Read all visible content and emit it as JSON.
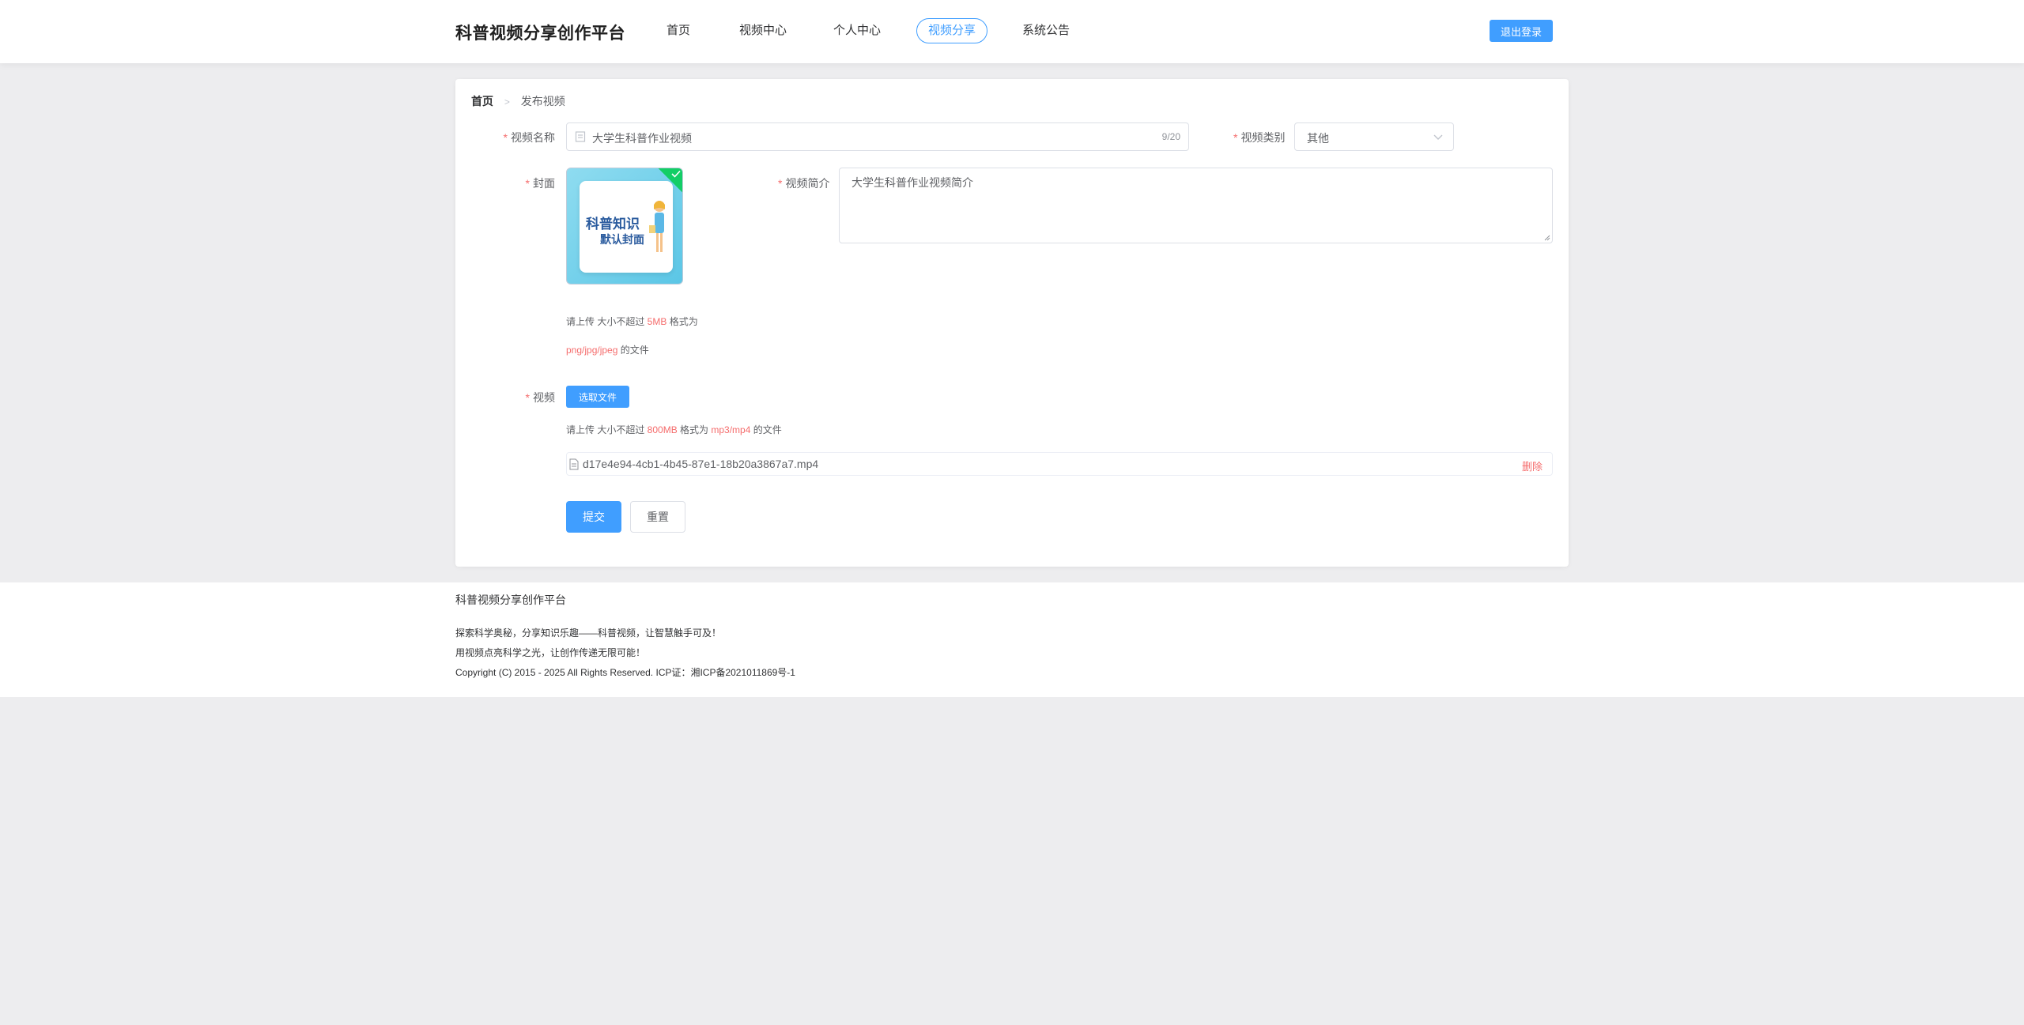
{
  "header": {
    "brand": "科普视频分享创作平台",
    "nav": [
      {
        "label": "首页",
        "active": false
      },
      {
        "label": "视频中心",
        "active": false
      },
      {
        "label": "个人中心",
        "active": false
      },
      {
        "label": "视频分享",
        "active": true
      },
      {
        "label": "系统公告",
        "active": false
      }
    ],
    "logout_label": "退出登录"
  },
  "breadcrumb": {
    "home": "首页",
    "current": "发布视频"
  },
  "form": {
    "title_label": "视频名称",
    "title_value": "大学生科普作业视频",
    "title_count": "9/20",
    "category_label": "视频类别",
    "category_value": "其他",
    "cover_label": "封面",
    "cover_image_text_1": "科普知识",
    "cover_image_text_2": "默认封面",
    "cover_hint_1_a": "请上传 大小不超过 ",
    "cover_hint_1_size": "5MB",
    "cover_hint_1_b": " 格式为",
    "cover_hint_2_formats": "png/jpg/jpeg",
    "cover_hint_2_b": " 的文件",
    "intro_label": "视频简介",
    "intro_value": "大学生科普作业视频简介",
    "video_label": "视频",
    "choose_file_label": "选取文件",
    "video_hint_a": "请上传 大小不超过 ",
    "video_hint_size": "800MB",
    "video_hint_b": " 格式为 ",
    "video_hint_formats": "mp3/mp4",
    "video_hint_c": " 的文件",
    "file_name": "d17e4e94-4cb1-4b45-87e1-18b20a3867a7.mp4",
    "delete_label": "删除",
    "submit_label": "提交",
    "reset_label": "重置"
  },
  "footer": {
    "title": "科普视频分享创作平台",
    "line1": "探索科学奥秘，分享知识乐趣——科普视频，让智慧触手可及！",
    "line2": "用视频点亮科学之光，让创作传递无限可能！",
    "copyright": "Copyright (C) 2015 - 2025 All Rights Reserved. ICP证：湘ICP备2021011869号-1"
  },
  "colors": {
    "primary": "#409eff",
    "danger": "#f56c6c",
    "success": "#13ce66"
  }
}
